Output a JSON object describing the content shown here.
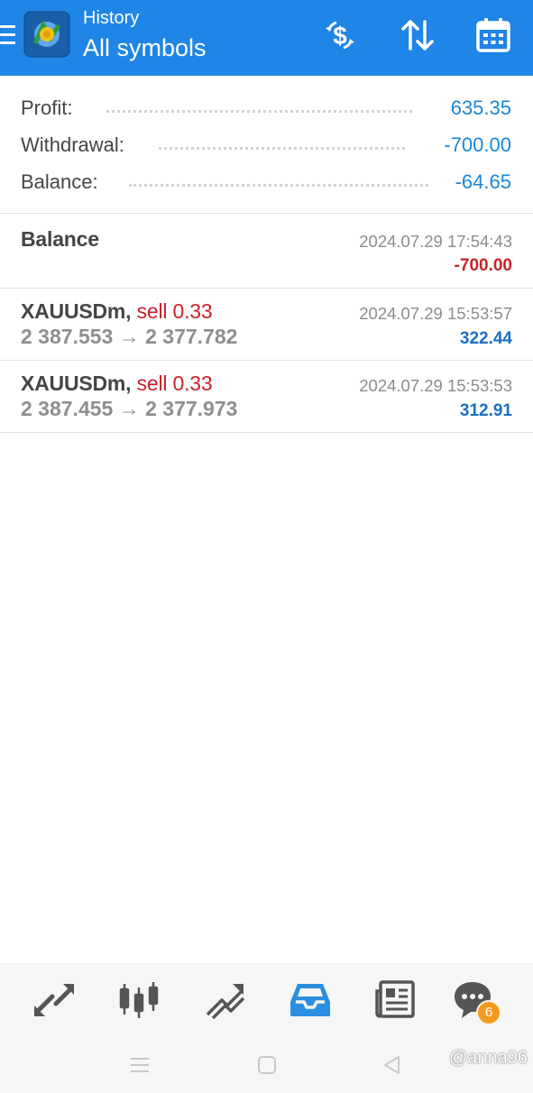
{
  "header": {
    "subtitle": "History",
    "title": "All symbols",
    "icons": [
      "menu-icon",
      "metatrader-logo",
      "deposit-withdraw-icon",
      "sort-icon",
      "calendar-icon"
    ]
  },
  "summary": {
    "profit_label": "Profit:",
    "profit_value": "635.35",
    "withdrawal_label": "Withdrawal:",
    "withdrawal_value": "-700.00",
    "balance_label": "Balance:",
    "balance_value": "-64.65"
  },
  "entries": [
    {
      "title": "Balance",
      "datetime": "2024.07.29 17:54:43",
      "amount": "-700.00"
    },
    {
      "symbol": "XAUUSDm,",
      "type": "sell 0.33",
      "datetime": "2024.07.29 15:53:57",
      "open_price": "2 387.553",
      "arrow": "→",
      "close_price": "2 377.782",
      "amount": "322.44"
    },
    {
      "symbol": "XAUUSDm,",
      "type": "sell 0.33",
      "datetime": "2024.07.29 15:53:53",
      "open_price": "2 387.455",
      "arrow": "→",
      "close_price": "2 377.973",
      "amount": "312.91"
    }
  ],
  "bottom_nav": {
    "items": [
      "quotes-icon",
      "chart-icon",
      "trade-icon",
      "history-icon",
      "news-icon",
      "chat-icon"
    ],
    "active": "history-icon",
    "chat_badge": "6"
  },
  "watermark": "@anna96",
  "colors": {
    "header_bg": "#1f85e6",
    "positive": "#1a6fc4",
    "negative": "#c8222a",
    "summary_value": "#1a86d9",
    "active_nav": "#2a8fe0",
    "inactive_nav": "#555555"
  }
}
